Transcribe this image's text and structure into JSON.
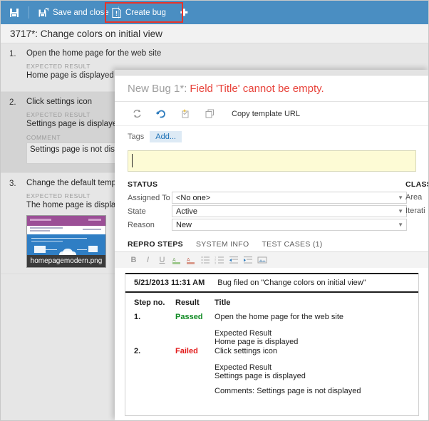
{
  "toolbar": {
    "save_icon": "save-disk-icon",
    "save_and_close_label": "Save and close",
    "save_and_close_icon": "save-and-close-icon",
    "create_bug_label": "Create bug",
    "create_bug_icon": "create-bug-icon",
    "create_bug_plus": "✦",
    "accent_color": "#4a8ec2",
    "highlight_color": "#e8342a"
  },
  "page": {
    "title": "3717*: Change colors on initial view"
  },
  "steps": [
    {
      "number": "1.",
      "title": "Open the home page for the web site",
      "expected_label": "EXPECTED RESULT",
      "expected_value": "Home page is displayed",
      "selected": false
    },
    {
      "number": "2.",
      "title": "Click settings icon",
      "expected_label": "EXPECTED RESULT",
      "expected_value": "Settings page is displayed",
      "comment_label": "COMMENT",
      "comment_value": "Settings page is not displayed",
      "selected": true
    },
    {
      "number": "3.",
      "title": "Change the default template",
      "expected_label": "EXPECTED RESULT",
      "expected_value": "The home page is displayed",
      "attachment": "homepagemodern.png",
      "selected": false
    }
  ],
  "dialog": {
    "title_prefix": "New Bug 1*:",
    "title_error": "Field 'Title' cannot be empty.",
    "error_color": "#e8443c",
    "tools": [
      {
        "name": "refresh-icon",
        "glyph": "refresh"
      },
      {
        "name": "undo-icon",
        "glyph": "undo"
      },
      {
        "name": "revert-icon",
        "glyph": "revert"
      },
      {
        "name": "copy-icon",
        "glyph": "copy"
      }
    ],
    "copy_template_url_label": "Copy template URL",
    "tags_label": "Tags",
    "tags_add_label": "Add...",
    "title_input_value": "",
    "title_input_placeholder": "",
    "status": {
      "heading": "STATUS",
      "fields": [
        {
          "label": "Assigned To",
          "value": "<No one>"
        },
        {
          "label": "State",
          "value": "Active"
        },
        {
          "label": "Reason",
          "value": "New"
        }
      ]
    },
    "classification": {
      "heading": "CLASS",
      "fields": [
        {
          "label": "Area"
        },
        {
          "label": "Iterati"
        }
      ]
    },
    "tabs": [
      {
        "label": "REPRO STEPS",
        "active": true
      },
      {
        "label": "SYSTEM INFO",
        "active": false
      },
      {
        "label": "TEST CASES (1)",
        "active": false
      }
    ],
    "format_bar": [
      {
        "name": "bold-icon",
        "glyph": "B"
      },
      {
        "name": "italic-icon",
        "glyph": "I"
      },
      {
        "name": "underline-icon",
        "glyph": "U"
      },
      {
        "name": "text-highlight-icon",
        "glyph": "A"
      },
      {
        "name": "clear-format-icon",
        "glyph": "A"
      },
      {
        "name": "bullet-list-icon",
        "glyph": "bullets"
      },
      {
        "name": "numbered-list-icon",
        "glyph": "numbers"
      },
      {
        "name": "outdent-icon",
        "glyph": "outdent"
      },
      {
        "name": "indent-icon",
        "glyph": "indent"
      },
      {
        "name": "insert-image-icon",
        "glyph": "image"
      }
    ],
    "repro": {
      "timestamp": "5/21/2013 11:31 AM",
      "headline": "Bug filed on \"Change colors on initial view\"",
      "columns": [
        "Step no.",
        "Result",
        "Title"
      ],
      "rows": [
        {
          "step": "1.",
          "result": "Passed",
          "result_color": "#0f8a23",
          "title": "Open the home page for the web site",
          "expected_label": "Expected Result",
          "expected_value": "Home page is displayed"
        },
        {
          "step": "2.",
          "result": "Failed",
          "result_color": "#e21b1b",
          "title": "Click settings icon",
          "expected_label": "Expected Result",
          "expected_value": "Settings page is displayed",
          "comment": "Comments: Settings page is not displayed"
        }
      ]
    }
  }
}
